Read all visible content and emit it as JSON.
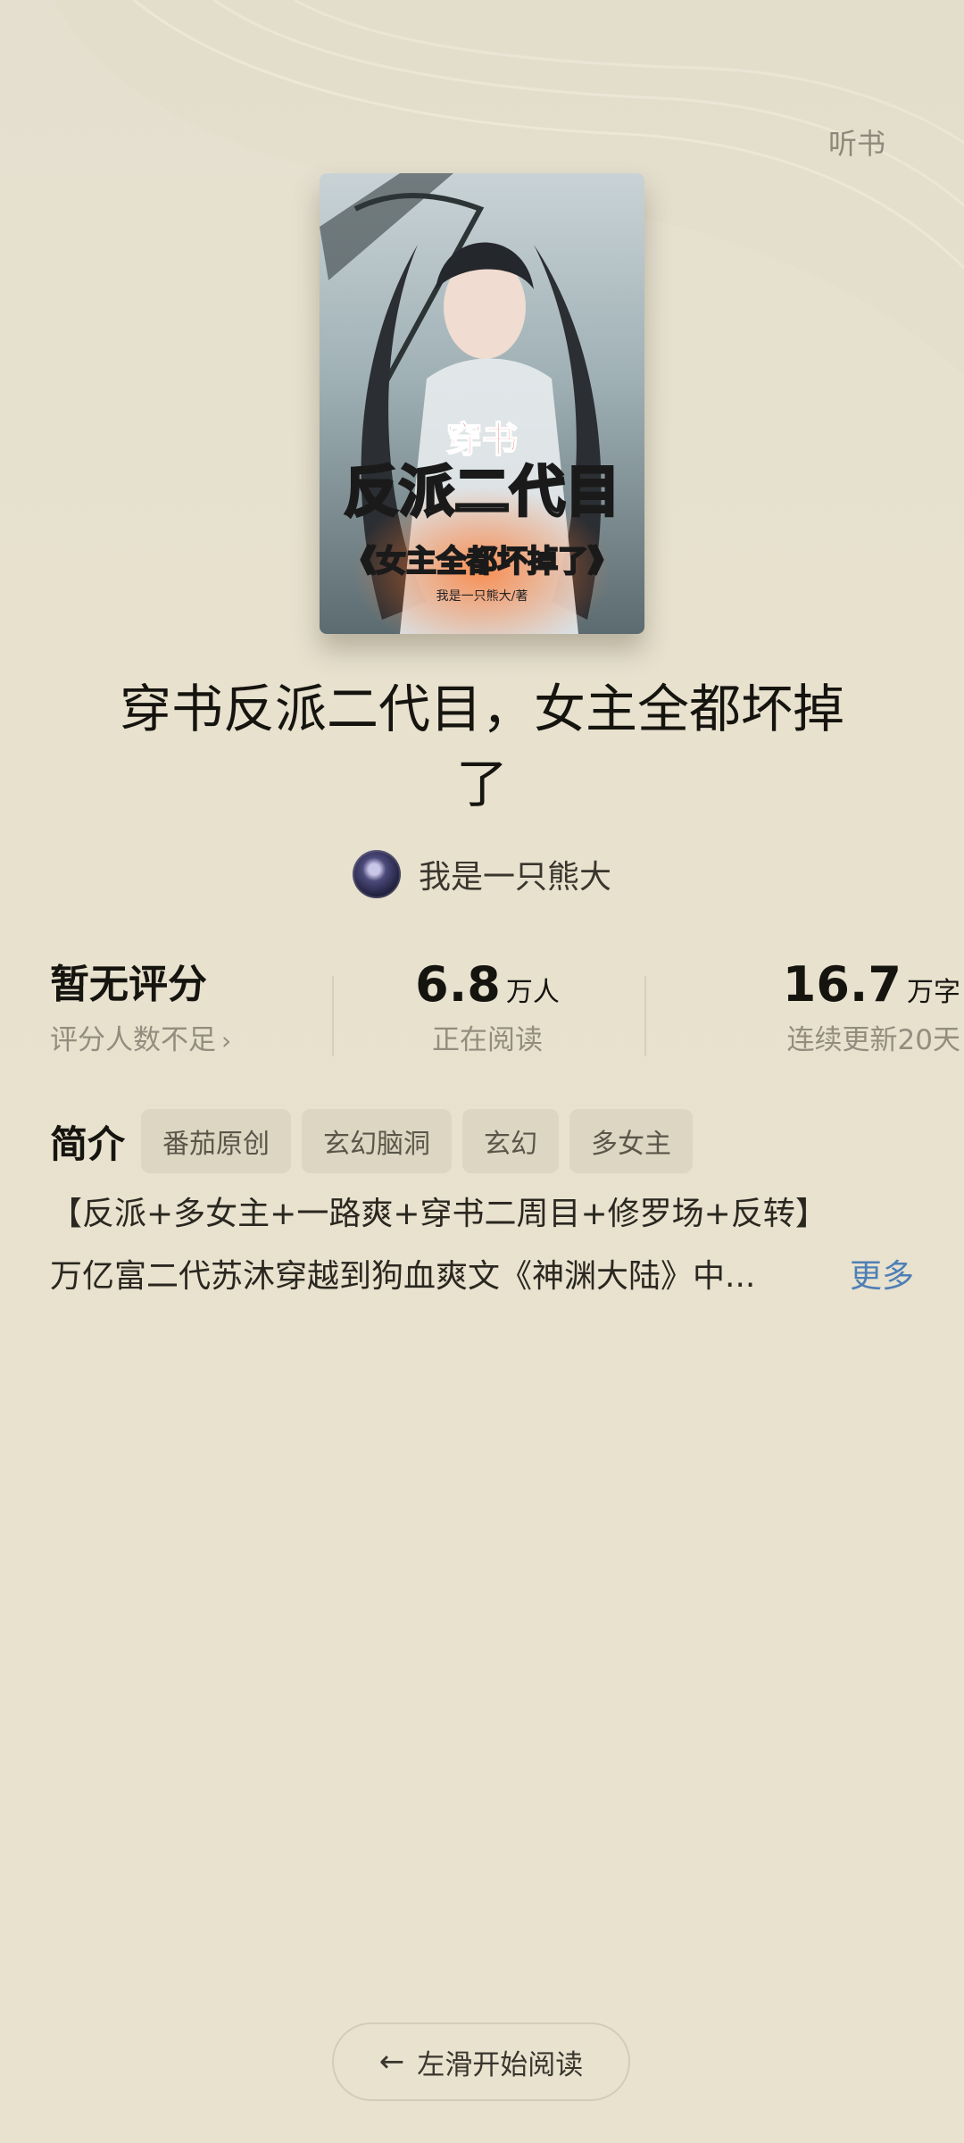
{
  "header": {
    "listen_label": "听书"
  },
  "book": {
    "cover": {
      "badge": "穿书",
      "title_main": "反派二代目",
      "title_sub": "《女主全都坏掉了》",
      "author_credit": "我是一只熊大/著"
    },
    "title": "穿书反派二代目，女主全都坏掉了",
    "author": "我是一只熊大"
  },
  "stats": {
    "rating": {
      "label": "暂无评分",
      "sub": "评分人数不足"
    },
    "readers": {
      "value": "6.8",
      "unit": "万人",
      "sub": "正在阅读"
    },
    "words": {
      "value": "16.7",
      "unit": "万字",
      "sub": "连续更新20天"
    }
  },
  "intro": {
    "label": "简介",
    "tags": [
      "番茄原创",
      "玄幻脑洞",
      "玄幻",
      "多女主"
    ],
    "line1": "【反派+多女主+一路爽+穿书二周目+修罗场+反转】",
    "line2": "万亿富二代苏沐穿越到狗血爽文《神渊大陆》中...",
    "more": "更多"
  },
  "footer": {
    "swipe_label": "左滑开始阅读"
  },
  "colors": {
    "background": "#e8e2cf",
    "link": "#4f7fb6",
    "tag_bg": "#ddd6c3"
  }
}
